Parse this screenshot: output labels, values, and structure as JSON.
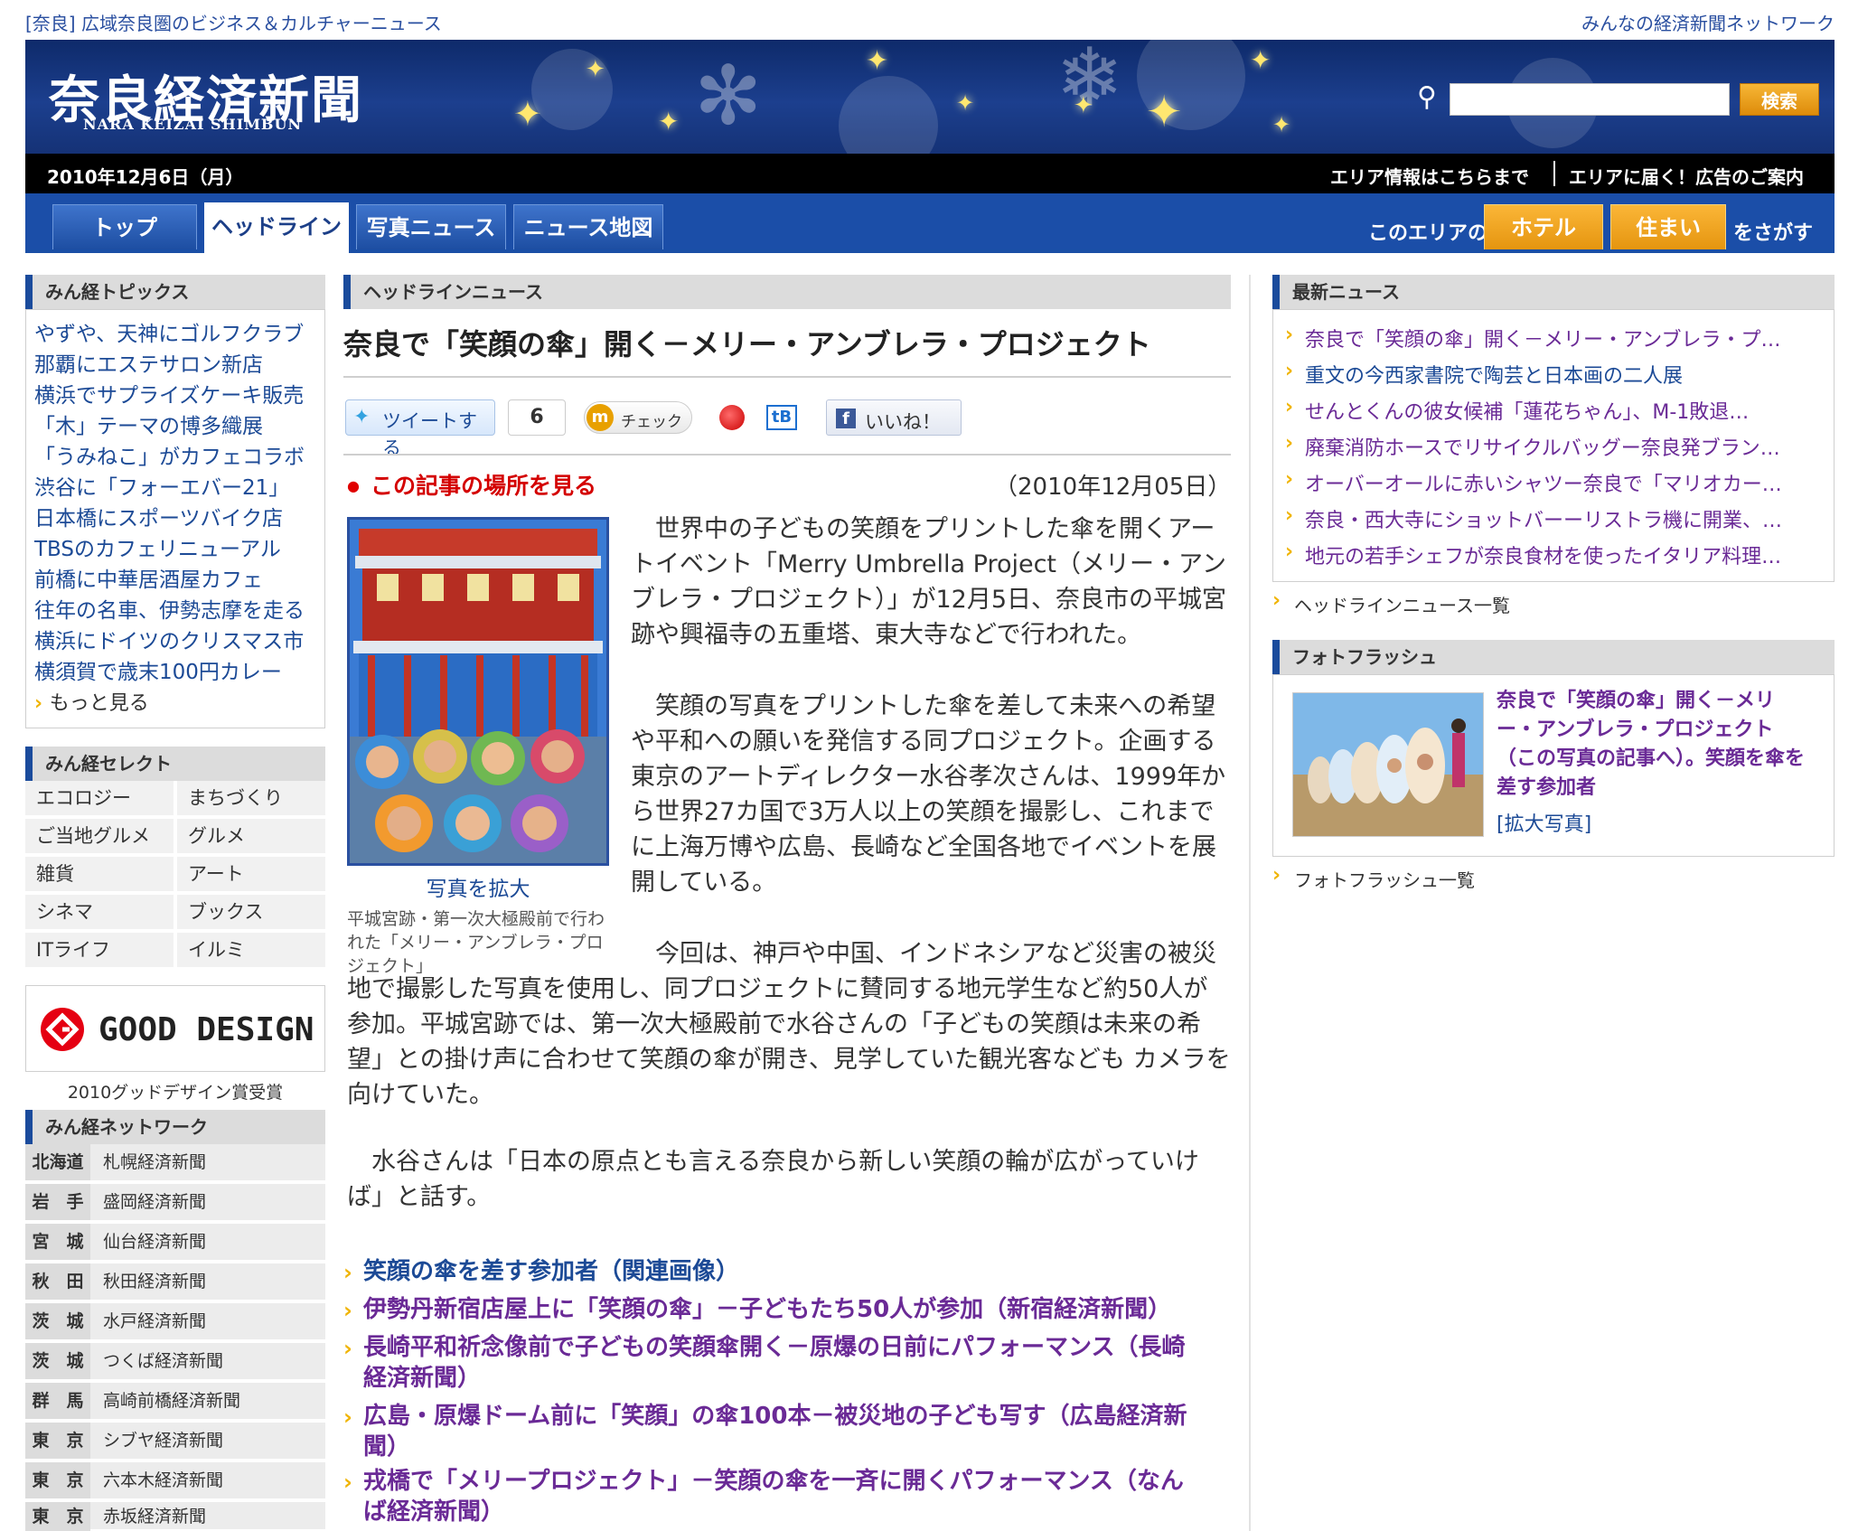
{
  "topstrip": {
    "left": "[奈良] 広域奈良圏のビジネス＆カルチャーニュース",
    "right": "みんなの経済新聞ネットワーク"
  },
  "header": {
    "logo": "奈良経済新聞",
    "logo_en": "NARA KEIZAI SHIMBUN",
    "search_placeholder": "",
    "search_button": "検索"
  },
  "datebar": {
    "date": "2010年12月6日（月）",
    "link1": "エリア情報はこちらまで",
    "link2": "エリアに届く！広告のご案内"
  },
  "nav": {
    "tabs": [
      "トップ",
      "ヘッドライン",
      "写真ニュース",
      "ニュース地図"
    ],
    "find_prefix": "このエリアの",
    "hotel": "ホテル",
    "housing": "住まい",
    "find_suffix": "をさがす"
  },
  "left": {
    "topics_title": "みん経トピックス",
    "topics": [
      "やずや、天神にゴルフクラブ",
      "那覇にエステサロン新店",
      "横浜でサプライズケーキ販売",
      "「木」テーマの博多織展",
      "「うみねこ」がカフェコラボ",
      "渋谷に「フォーエバー21」",
      "日本橋にスポーツバイク店",
      "TBSのカフェリニューアル",
      "前橋に中華居酒屋カフェ",
      "往年の名車、伊勢志摩を走る",
      "横浜にドイツのクリスマス市",
      "横須賀で歳末100円カレー"
    ],
    "more": "もっと見る",
    "select_title": "みん経セレクト",
    "select": [
      [
        "エコロジー",
        "まちづくり"
      ],
      [
        "ご当地グルメ",
        "グルメ"
      ],
      [
        "雑貨",
        "アート"
      ],
      [
        "シネマ",
        "ブックス"
      ],
      [
        "ITライフ",
        "イルミ"
      ]
    ],
    "good_design": "GOOD DESIGN",
    "good_design_caption": "2010グッドデザイン賞受賞",
    "network_title": "みん経ネットワーク",
    "network": [
      {
        "pref": "北海道",
        "name": "札幌経済新聞"
      },
      {
        "pref": "岩　手",
        "name": "盛岡経済新聞"
      },
      {
        "pref": "宮　城",
        "name": "仙台経済新聞"
      },
      {
        "pref": "秋　田",
        "name": "秋田経済新聞"
      },
      {
        "pref": "茨　城",
        "name": "水戸経済新聞"
      },
      {
        "pref": "茨　城",
        "name": "つくば経済新聞"
      },
      {
        "pref": "群　馬",
        "name": "高崎前橋経済新聞"
      },
      {
        "pref": "東　京",
        "name": "シブヤ経済新聞"
      },
      {
        "pref": "東　京",
        "name": "六本木経済新聞"
      },
      {
        "pref": "東　京",
        "name": "赤坂経済新聞"
      }
    ]
  },
  "main": {
    "section_title": "ヘッドラインニュース",
    "headline": "奈良で「笑顔の傘」開く－メリー・アンブレラ・プロジェクト",
    "tweet": "ツイートする",
    "tweet_count": "6",
    "check": "チェック",
    "hatena": "tB",
    "like": "いいね！",
    "map_link": "この記事の場所を見る",
    "date": "（2010年12月05日）",
    "photo_enlarge": "写真を拡大",
    "photo_caption": "平城宮跡・第一次大極殿前で行われた「メリー・アンブレラ・プロジェクト」",
    "para1": "　世界中の子どもの笑顔をプリントした傘を開くアートイベント「Merry Umbrella Project（メリー・アンブレラ・プロジェクト）」が12月5日、奈良市の平城宮跡や興福寺の五重塔、東大寺などで行われた。",
    "para2": "　笑顔の写真をプリントした傘を差して未来への希望や平和への願いを発信する同プロジェクト。企画する東京のアートディレクター水谷孝次さんは、1999年から世界27カ国で3万人以上の笑顔を撮影し、これまでに上海万博や広島、長崎など全国各地でイベントを展開している。",
    "para3": "　今回は、神戸や中国、インドネシアなど災害の被災地で撮影した写真を使用し、同プロジェクトに賛同する地元学生など約50人が参加。平城宮跡では、第一次大極殿前で水谷さんの「子どもの笑顔は未来の希望」との掛け声に合わせて笑顔の傘が開き、見学していた観光客なども カメラを向けていた。",
    "para4": "　水谷さんは「日本の原点とも言える奈良から新しい笑顔の輪が広がっていけば」と話す。",
    "related": [
      "笑顔の傘を差す参加者（関連画像）",
      "伊勢丹新宿店屋上に「笑顔の傘」－子どもたち50人が参加（新宿経済新聞）",
      "長崎平和祈念像前で子どもの笑顔傘開く－原爆の日前にパフォーマンス（長崎",
      "経済新聞）",
      "広島・原爆ドーム前に「笑顔」の傘100本－被災地の子ども写す（広島経済新",
      "聞）",
      "戎橋で「メリープロジェクト」－笑顔の傘を一斉に開くパフォーマンス（なん",
      "ば経済新聞）"
    ]
  },
  "right": {
    "latest_title": "最新ニュース",
    "latest": [
      "奈良で「笑顔の傘」開く－メリー・アンブレラ・プ…",
      "重文の今西家書院で陶芸と日本画の二人展",
      "せんとくんの彼女候補「蓮花ちゃん」、M-1敗退…",
      "廃棄消防ホースでリサイクルバッグー奈良発ブラン…",
      "オーバーオールに赤いシャツー奈良で「マリオカー…",
      "奈良・西大寺にショットバーーリストラ機に開業、…",
      "地元の若手シェフが奈良食材を使ったイタリア料理…"
    ],
    "headline_list": "ヘッドラインニュース一覧",
    "flash_title": "フォトフラッシュ",
    "flash_text": "奈良で「笑顔の傘」開く－メリー・アンブレラ・プロジェクト（この写真の記事へ）。笑顔を傘を差す参加者",
    "flash_enlarge": "[拡大写真]",
    "flash_list": "フォトフラッシュ一覧"
  }
}
